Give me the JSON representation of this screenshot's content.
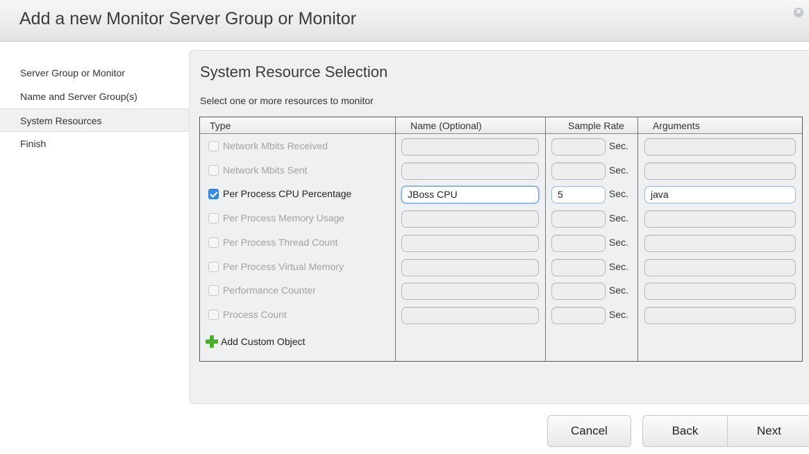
{
  "dialog": {
    "title": "Add a new Monitor Server Group or Monitor",
    "close_icon": "close-icon"
  },
  "sidebar": {
    "items": [
      {
        "label": "Server Group or Monitor",
        "active": false
      },
      {
        "label": "Name and Server Group(s)",
        "active": false
      },
      {
        "label": "System Resources",
        "active": true
      },
      {
        "label": "Finish",
        "active": false
      }
    ]
  },
  "main": {
    "heading": "System Resource Selection",
    "subtitle": "Select one or more resources to monitor",
    "columns": [
      "Type",
      "Name (Optional)",
      "Sample Rate",
      "Arguments"
    ],
    "sec_label": "Sec.",
    "rows": [
      {
        "type": "Network Mbits Received",
        "checked": false,
        "name": "",
        "rate": "",
        "args": ""
      },
      {
        "type": "Network Mbits Sent",
        "checked": false,
        "name": "",
        "rate": "",
        "args": ""
      },
      {
        "type": "Per Process CPU Percentage",
        "checked": true,
        "name": "JBoss CPU",
        "rate": "5",
        "args": "java"
      },
      {
        "type": "Per Process Memory Usage",
        "checked": false,
        "name": "",
        "rate": "",
        "args": ""
      },
      {
        "type": "Per Process Thread Count",
        "checked": false,
        "name": "",
        "rate": "",
        "args": ""
      },
      {
        "type": "Per Process Virtual Memory",
        "checked": false,
        "name": "",
        "rate": "",
        "args": ""
      },
      {
        "type": "Performance Counter",
        "checked": false,
        "name": "",
        "rate": "",
        "args": ""
      },
      {
        "type": "Process Count",
        "checked": false,
        "name": "",
        "rate": "",
        "args": ""
      }
    ],
    "add_custom_label": "Add Custom Object",
    "add_custom_icon": "plus-icon",
    "accent_color": "#3b8be8",
    "add_icon_color": "#4caf2b"
  },
  "footer": {
    "cancel_label": "Cancel",
    "back_label": "Back",
    "next_label": "Next"
  }
}
